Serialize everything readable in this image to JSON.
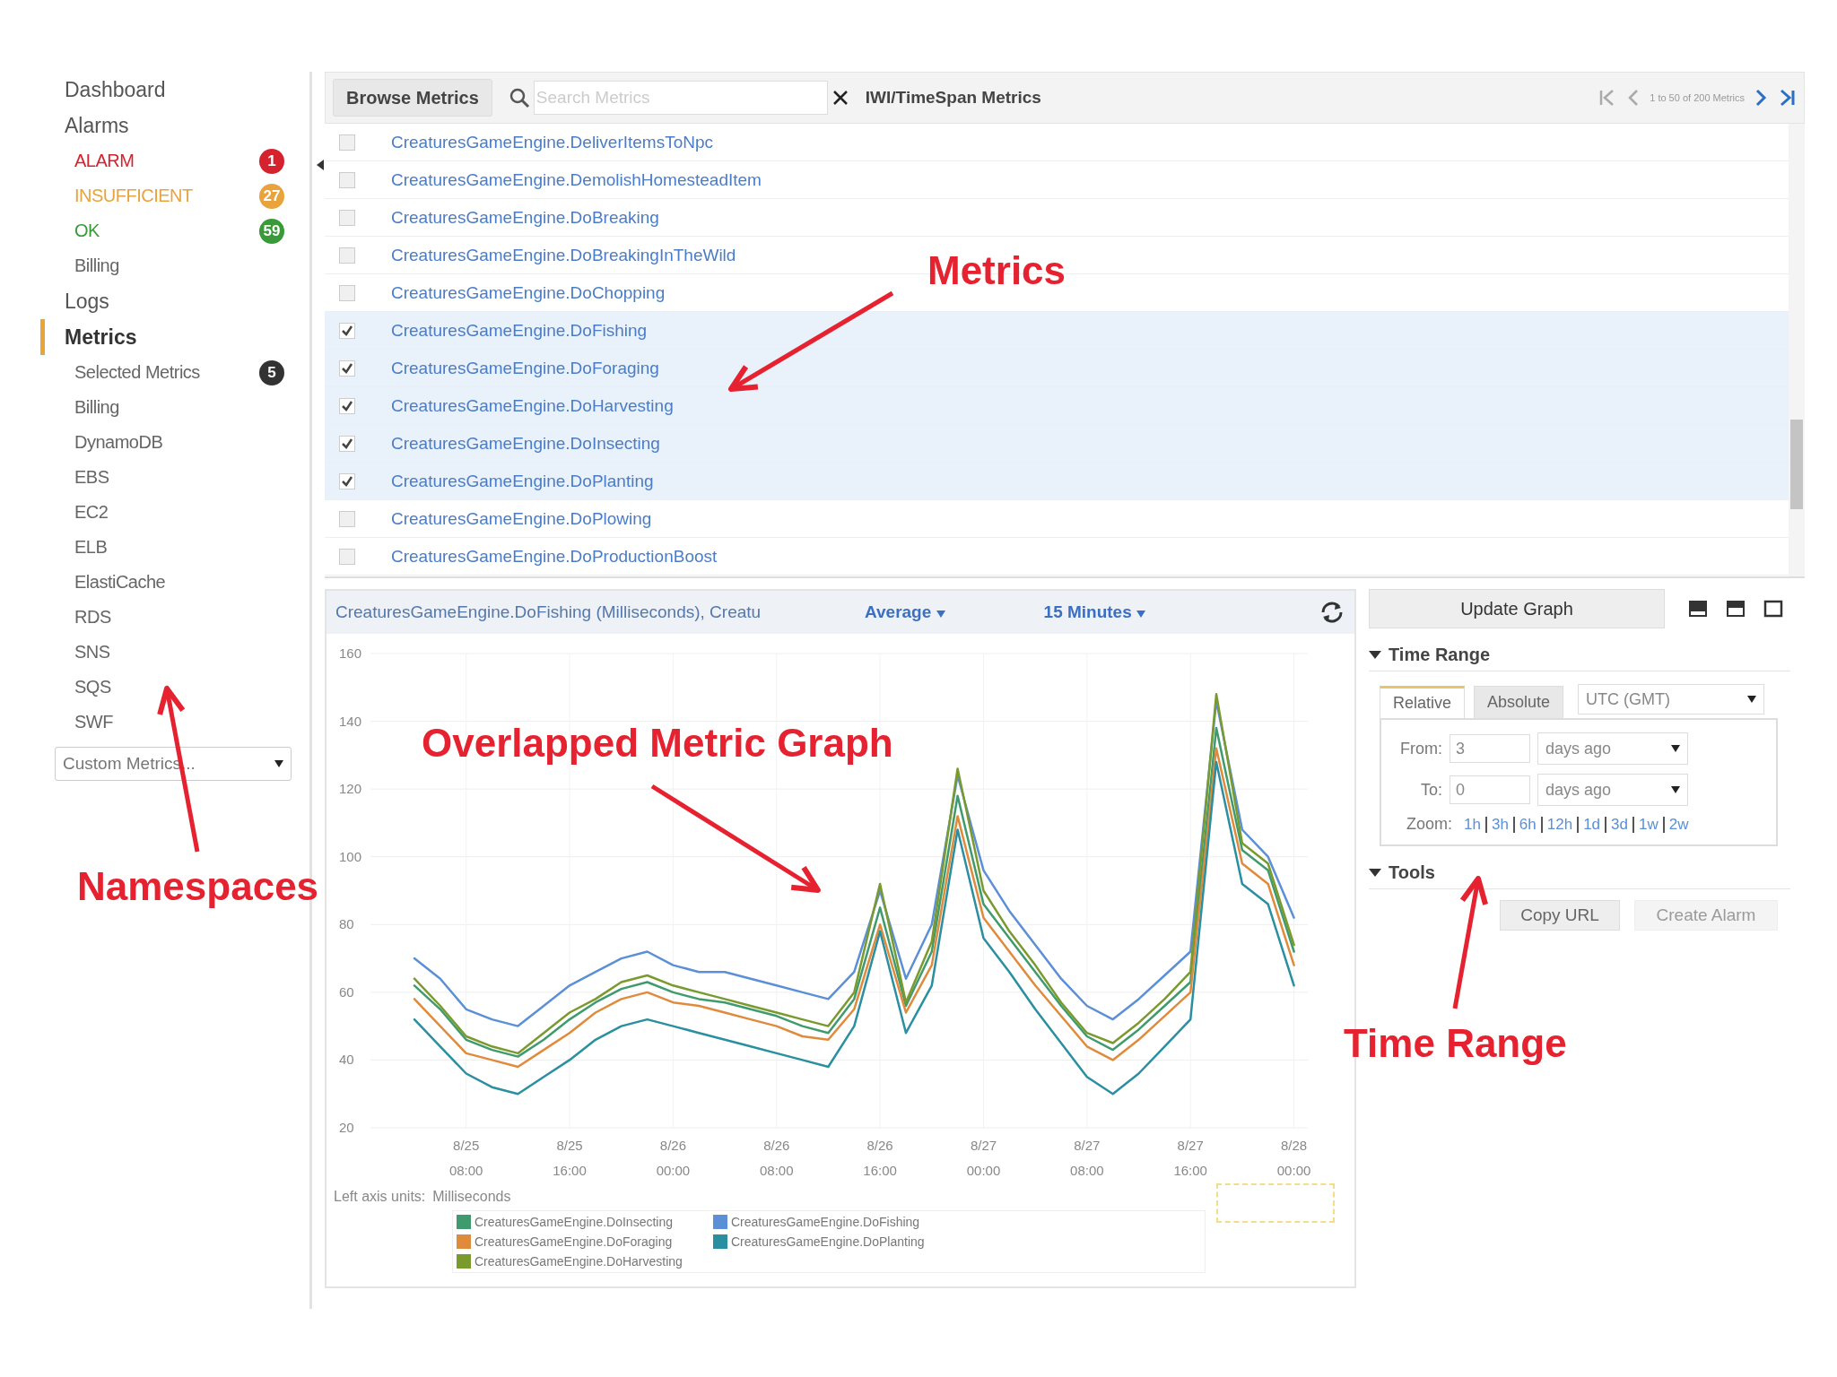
{
  "sidebar": {
    "nav": [
      {
        "label": "Dashboard",
        "selected": false
      },
      {
        "label": "Alarms",
        "selected": false,
        "children": [
          {
            "label": "ALARM",
            "selected": false,
            "color": "#d4232e",
            "badge": "1"
          },
          {
            "label": "INSUFFICIENT",
            "selected": false,
            "color": "#e8a33c",
            "badge": "27"
          },
          {
            "label": "OK",
            "selected": false,
            "color": "#3a9a3a",
            "badge": "59"
          },
          {
            "label": "Billing",
            "selected": false
          }
        ]
      },
      {
        "label": "Logs",
        "selected": false
      },
      {
        "label": "Metrics",
        "selected": true,
        "children": [
          {
            "label": "Selected Metrics",
            "selected": false,
            "badge": "5"
          },
          {
            "label": "Billing",
            "selected": false
          },
          {
            "label": "DynamoDB",
            "selected": false
          },
          {
            "label": "EBS",
            "selected": false
          },
          {
            "label": "EC2",
            "selected": false
          },
          {
            "label": "ELB",
            "selected": false
          },
          {
            "label": "ElastiCache",
            "selected": false
          },
          {
            "label": "RDS",
            "selected": false
          },
          {
            "label": "SNS",
            "selected": false
          },
          {
            "label": "SQS",
            "selected": false
          },
          {
            "label": "SWF",
            "selected": false
          }
        ]
      }
    ],
    "namespace_select": "Custom Metrics..."
  },
  "toolbar": {
    "browse_button": "Browse Metrics",
    "search": {
      "placeholder": "Search Metrics"
    },
    "namespace_title": "IWI/TimeSpan Metrics",
    "pagination": "1 to 50 of 200 Metrics"
  },
  "metrics": [
    {
      "name": "CreaturesGameEngine.DeliverItemsToNpc",
      "checked": false
    },
    {
      "name": "CreaturesGameEngine.DemolishHomesteadItem",
      "checked": false
    },
    {
      "name": "CreaturesGameEngine.DoBreaking",
      "checked": false
    },
    {
      "name": "CreaturesGameEngine.DoBreakingInTheWild",
      "checked": false
    },
    {
      "name": "CreaturesGameEngine.DoChopping",
      "checked": false
    },
    {
      "name": "CreaturesGameEngine.DoFishing",
      "checked": true
    },
    {
      "name": "CreaturesGameEngine.DoForaging",
      "checked": true
    },
    {
      "name": "CreaturesGameEngine.DoHarvesting",
      "checked": true
    },
    {
      "name": "CreaturesGameEngine.DoInsecting",
      "checked": true
    },
    {
      "name": "CreaturesGameEngine.DoPlanting",
      "checked": true
    },
    {
      "name": "CreaturesGameEngine.DoPlowing",
      "checked": false
    },
    {
      "name": "CreaturesGameEngine.DoProductionBoost",
      "checked": false
    }
  ],
  "graph": {
    "title": "CreaturesGameEngine.DoFishing (Milliseconds), Creatu",
    "statistic": "Average",
    "period": "15 Minutes",
    "axis_units_label": "Left axis units:",
    "axis_units": "Milliseconds",
    "chart_data": {
      "type": "line",
      "categories": [
        null,
        null,
        "8/25 08:00",
        null,
        null,
        null,
        "8/25 16:00",
        null,
        null,
        null,
        "8/26 00:00",
        null,
        null,
        null,
        "8/26 08:00",
        null,
        null,
        null,
        "8/26 16:00",
        null,
        null,
        null,
        "8/27 00:00",
        null,
        null,
        null,
        "8/27 08:00",
        null,
        null,
        null,
        "8/27 16:00",
        null,
        null,
        null,
        "8/28 00:00"
      ],
      "ylim": [
        20,
        160
      ],
      "grid": true,
      "yticks": [
        20,
        40,
        60,
        80,
        100,
        120,
        140,
        160
      ],
      "series": [
        {
          "name": "CreaturesGameEngine.DoInsecting",
          "color": "#3f9b6e",
          "values": [
            62,
            55,
            46,
            43,
            41,
            46,
            52,
            57,
            61,
            63,
            60,
            58,
            57,
            55,
            53,
            50,
            48,
            58,
            85,
            56,
            72,
            118,
            86,
            76,
            66,
            56,
            47,
            43,
            49,
            56,
            63,
            138,
            102,
            96,
            72
          ]
        },
        {
          "name": "CreaturesGameEngine.DoFishing",
          "color": "#5b8fd6",
          "values": [
            70,
            64,
            55,
            52,
            50,
            56,
            62,
            66,
            70,
            72,
            68,
            66,
            66,
            64,
            62,
            60,
            58,
            66,
            90,
            64,
            80,
            124,
            96,
            84,
            74,
            64,
            56,
            52,
            58,
            65,
            72,
            146,
            108,
            100,
            82
          ]
        },
        {
          "name": "CreaturesGameEngine.DoForaging",
          "color": "#e08a3c",
          "values": [
            58,
            50,
            42,
            40,
            38,
            43,
            48,
            54,
            58,
            60,
            57,
            56,
            54,
            52,
            50,
            47,
            46,
            55,
            80,
            54,
            68,
            112,
            82,
            72,
            62,
            53,
            44,
            40,
            46,
            53,
            60,
            132,
            98,
            92,
            68
          ]
        },
        {
          "name": "CreaturesGameEngine.DoPlanting",
          "color": "#2a8fa0",
          "values": [
            52,
            44,
            36,
            32,
            30,
            35,
            40,
            46,
            50,
            52,
            50,
            48,
            46,
            44,
            42,
            40,
            38,
            50,
            78,
            48,
            62,
            108,
            76,
            66,
            55,
            45,
            35,
            30,
            36,
            44,
            52,
            128,
            92,
            86,
            62
          ]
        },
        {
          "name": "CreaturesGameEngine.DoHarvesting",
          "color": "#7a9a2e",
          "values": [
            64,
            56,
            47,
            44,
            42,
            48,
            54,
            58,
            63,
            65,
            62,
            60,
            58,
            56,
            54,
            52,
            50,
            60,
            92,
            57,
            75,
            126,
            90,
            78,
            68,
            57,
            48,
            45,
            51,
            58,
            66,
            148,
            104,
            98,
            74
          ]
        }
      ]
    }
  },
  "controls": {
    "update_button": "Update Graph"
  },
  "time_range": {
    "title": "Time Range",
    "expanded": true,
    "tabs": [
      {
        "label": "Relative",
        "selected": true
      },
      {
        "label": "Absolute",
        "selected": false
      }
    ],
    "timezone": "UTC (GMT)",
    "from": {
      "label": "From:",
      "value": "3",
      "unit": "days ago"
    },
    "to": {
      "label": "To:",
      "value": "0",
      "unit": "days ago"
    },
    "zoom_label": "Zoom:",
    "zoom_links": [
      "1h",
      "3h",
      "6h",
      "12h",
      "1d",
      "3d",
      "1w",
      "2w"
    ]
  },
  "tools": {
    "title": "Tools",
    "expanded": true,
    "buttons": [
      {
        "label": "Copy URL",
        "disabled": false
      },
      {
        "label": "Create Alarm",
        "disabled": true
      }
    ]
  },
  "annotations": [
    {
      "text": "Metrics"
    },
    {
      "text": "Overlapped Metric Graph"
    },
    {
      "text": "Namespaces"
    },
    {
      "text": "Time Range"
    }
  ]
}
